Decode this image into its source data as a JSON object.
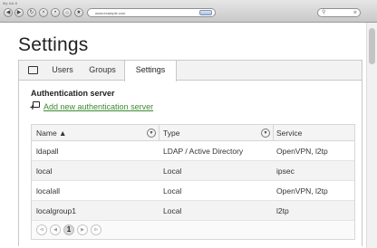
{
  "browser": {
    "tab_title": "My AA 8",
    "url": "www.example.com",
    "back_icon": "arrow-left-icon",
    "forward_icon": "arrow-right-icon"
  },
  "page": {
    "title": "Settings"
  },
  "tabs": {
    "icon": "monitor-icon",
    "items": [
      {
        "label": "Users"
      },
      {
        "label": "Groups"
      },
      {
        "label": "Settings",
        "active": true
      }
    ]
  },
  "auth": {
    "section_title": "Authentication server",
    "add_link": "Add new authentication server",
    "link_color": "#3a8a2f"
  },
  "table": {
    "columns": {
      "name": "Name ▲",
      "type": "Type",
      "service": "Service"
    },
    "rows": [
      {
        "name": "ldapall",
        "type": "LDAP / Active Directory",
        "service": "OpenVPN, l2tp"
      },
      {
        "name": "local",
        "type": "Local",
        "service": "ipsec"
      },
      {
        "name": "localall",
        "type": "Local",
        "service": "OpenVPN, l2tp"
      },
      {
        "name": "localgroup1",
        "type": "Local",
        "service": "l2tp"
      }
    ]
  },
  "pager": {
    "first": "⧏",
    "prev": "◀",
    "current_page": "1",
    "next": "▶",
    "last": "⧐"
  }
}
